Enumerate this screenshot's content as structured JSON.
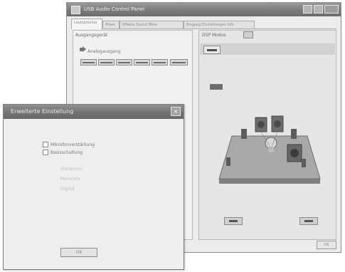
{
  "main_window": {
    "title": "USB Audio Control Panel",
    "tabs": [
      {
        "label": "Lautsprecher"
      },
      {
        "label": "Mixer"
      },
      {
        "label": "Effekte Sound Mitte"
      },
      {
        "label": "Eingang Einstellungen Info"
      }
    ],
    "left_panel": {
      "header": "Ausgangsgerät",
      "item_label": "Analogausgang"
    },
    "right_panel": {
      "header": "DSP Modus"
    },
    "corner_button_label": "OK"
  },
  "dialog": {
    "title": "Erweiterte Einstellung",
    "close_glyph": "×",
    "options": [
      {
        "label": "Mikrofonverstärkung",
        "checked": false
      },
      {
        "label": "Basisschaltung",
        "checked": false
      }
    ],
    "sub_options": [
      "Stereomix",
      "Monomix",
      "Digital"
    ],
    "ok_label": "OK"
  }
}
